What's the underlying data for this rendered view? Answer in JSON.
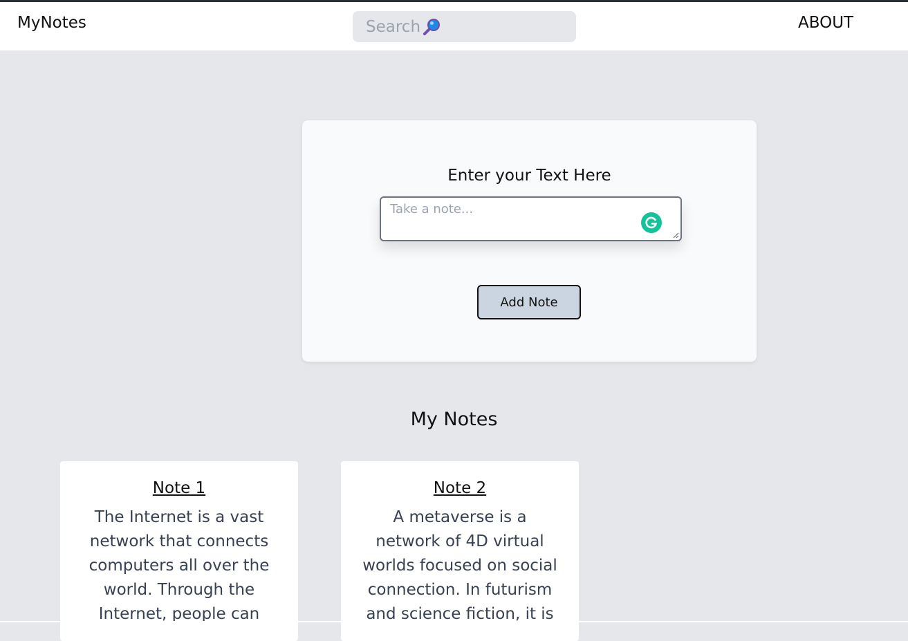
{
  "navbar": {
    "brand": "MyNotes",
    "search_placeholder": "Search",
    "search_icon": "magnifier-icon",
    "about": "ABOUT"
  },
  "editor": {
    "heading": "Enter your Text Here",
    "textarea_placeholder": "Take a note...",
    "textarea_value": "",
    "grammarly_icon": "grammarly-icon",
    "add_button": "Add Note"
  },
  "notes_section": {
    "title": "My Notes",
    "notes": [
      {
        "title": "Note 1",
        "body": "The Internet is a vast network that connects computers all over the world. Through the Internet, people can"
      },
      {
        "title": "Note 2",
        "body": "A metaverse is a network of 4D virtual worlds focused on social connection. In futurism and science fiction, it is"
      }
    ]
  },
  "colors": {
    "page_background": "#e5e7eb",
    "navbar_background": "#ffffff",
    "card_background": "#f9fafb",
    "button_background": "#cbd5e1",
    "grammarly_green": "#15c39a"
  }
}
